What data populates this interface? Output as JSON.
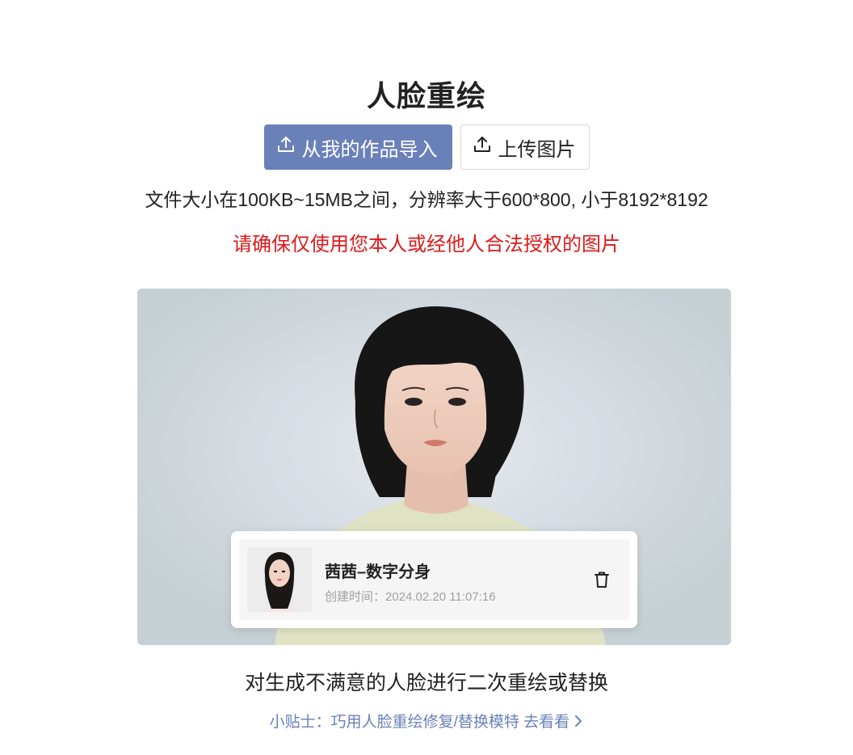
{
  "page": {
    "title": "人脸重绘"
  },
  "actions": {
    "import_label": "从我的作品导入",
    "upload_label": "上传图片"
  },
  "requirements": {
    "size_text": "文件大小在100KB~15MB之间，分辨率大于600*800, 小于8192*8192",
    "warning_text": "请确保仅使用您本人或经他人合法授权的图片"
  },
  "avatar_card": {
    "name": "茜茜–数字分身",
    "created_label": "创建时间：",
    "created_time": "2024.02.20 11:07:16"
  },
  "footer": {
    "caption": "对生成不满意的人脸进行二次重绘或替换",
    "tip_prefix": "小贴士：巧用人脸重绘修复/替换模特",
    "tip_link": "去看看",
    "tip_chevron": "chevron-right-icon"
  },
  "colors": {
    "primary": "#6a80b9",
    "warning": "#e0191b"
  }
}
